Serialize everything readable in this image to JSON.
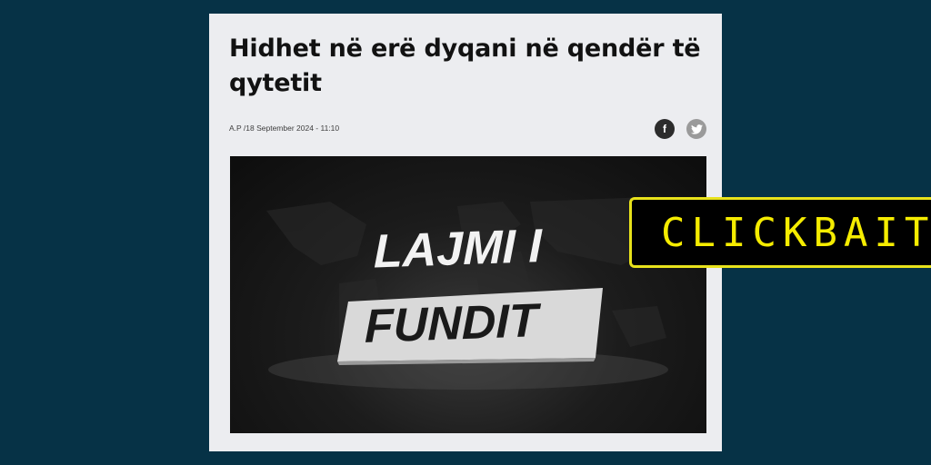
{
  "article": {
    "title": "Hidhet në erë dyqani në qendër të qytetit",
    "meta": "A.P /18 September 2024 - 11:10",
    "share": {
      "facebook": "f",
      "twitter_icon": "twitter-bird-icon"
    },
    "hero": {
      "line1": "LAJMI I",
      "line2": "FUNDIT"
    }
  },
  "label": {
    "text": "CLICKBAIT",
    "color": "#f5ec00",
    "border": "#e8e21b"
  },
  "colors": {
    "background": "#063246",
    "card": "#ecedf0"
  }
}
